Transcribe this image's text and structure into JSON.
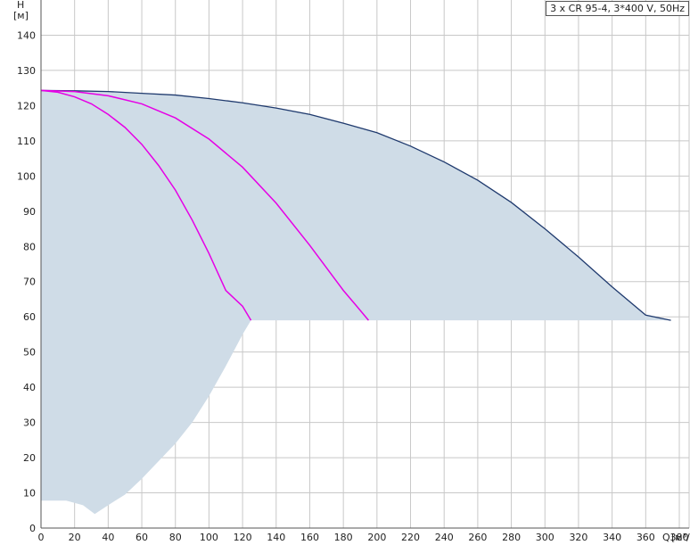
{
  "chart_data": {
    "type": "line",
    "title": "3 x CR 95-4, 3*400 V, 50Hz",
    "xlabel": "Q",
    "xunit": "[м³/ч]",
    "ylabel": "H",
    "yunit": "[м]",
    "xlim": [
      0,
      380
    ],
    "ylim": [
      0,
      150
    ],
    "x_ticks": [
      0,
      20,
      40,
      60,
      80,
      100,
      120,
      140,
      160,
      180,
      200,
      220,
      240,
      260,
      280,
      300,
      320,
      340,
      360,
      380
    ],
    "y_ticks": [
      0,
      10,
      20,
      30,
      40,
      50,
      60,
      70,
      80,
      90,
      100,
      110,
      120,
      130,
      140
    ],
    "grid": true,
    "colors": {
      "area_fill": "#cfdce7",
      "max_curve": "#1f3a6e",
      "curve": "#e600e6",
      "grid": "#c8c8c8"
    },
    "area": {
      "upper": [
        [
          0,
          124.3
        ],
        [
          20,
          124.2
        ],
        [
          40,
          124
        ],
        [
          60,
          123.5
        ],
        [
          80,
          123
        ],
        [
          100,
          122
        ],
        [
          120,
          120.8
        ],
        [
          140,
          119.3
        ],
        [
          160,
          117.5
        ],
        [
          180,
          115
        ],
        [
          200,
          112.3
        ],
        [
          220,
          108.5
        ],
        [
          240,
          104
        ],
        [
          260,
          98.8
        ],
        [
          280,
          92.5
        ],
        [
          300,
          85
        ],
        [
          320,
          77
        ],
        [
          340,
          68.5
        ],
        [
          360,
          60.5
        ],
        [
          375,
          59
        ]
      ],
      "lower": [
        [
          375,
          59
        ],
        [
          125,
          59
        ],
        [
          120,
          55
        ],
        [
          110,
          46
        ],
        [
          100,
          37.5
        ],
        [
          90,
          30
        ],
        [
          80,
          24
        ],
        [
          70,
          19
        ],
        [
          60,
          14
        ],
        [
          50,
          9.5
        ],
        [
          40,
          6.5
        ],
        [
          32,
          4
        ],
        [
          25,
          6.5
        ],
        [
          15,
          7.8
        ],
        [
          0,
          7.8
        ]
      ]
    },
    "series": [
      {
        "color": "#1f3a6e",
        "points": [
          [
            0,
            124.3
          ],
          [
            20,
            124.2
          ],
          [
            40,
            124
          ],
          [
            60,
            123.5
          ],
          [
            80,
            123
          ],
          [
            100,
            122
          ],
          [
            120,
            120.8
          ],
          [
            140,
            119.3
          ],
          [
            160,
            117.5
          ],
          [
            180,
            115
          ],
          [
            200,
            112.3
          ],
          [
            220,
            108.5
          ],
          [
            240,
            104
          ],
          [
            260,
            98.8
          ],
          [
            280,
            92.5
          ],
          [
            300,
            85
          ],
          [
            320,
            77
          ],
          [
            340,
            68.5
          ],
          [
            360,
            60.5
          ],
          [
            375,
            59
          ]
        ]
      },
      {
        "color": "#e600e6",
        "points": [
          [
            0,
            124.3
          ],
          [
            20,
            124
          ],
          [
            40,
            122.8
          ],
          [
            60,
            120.5
          ],
          [
            80,
            116.5
          ],
          [
            100,
            110.5
          ],
          [
            120,
            102.5
          ],
          [
            140,
            92.3
          ],
          [
            160,
            80.3
          ],
          [
            180,
            67.5
          ],
          [
            188,
            63
          ],
          [
            195,
            59
          ]
        ]
      },
      {
        "color": "#e600e6",
        "points": [
          [
            0,
            124.3
          ],
          [
            10,
            123.8
          ],
          [
            20,
            122.5
          ],
          [
            30,
            120.5
          ],
          [
            40,
            117.5
          ],
          [
            50,
            113.8
          ],
          [
            60,
            109
          ],
          [
            70,
            103
          ],
          [
            80,
            96
          ],
          [
            90,
            87.5
          ],
          [
            100,
            78
          ],
          [
            110,
            67.5
          ],
          [
            120,
            63
          ],
          [
            125,
            59
          ]
        ]
      }
    ]
  }
}
